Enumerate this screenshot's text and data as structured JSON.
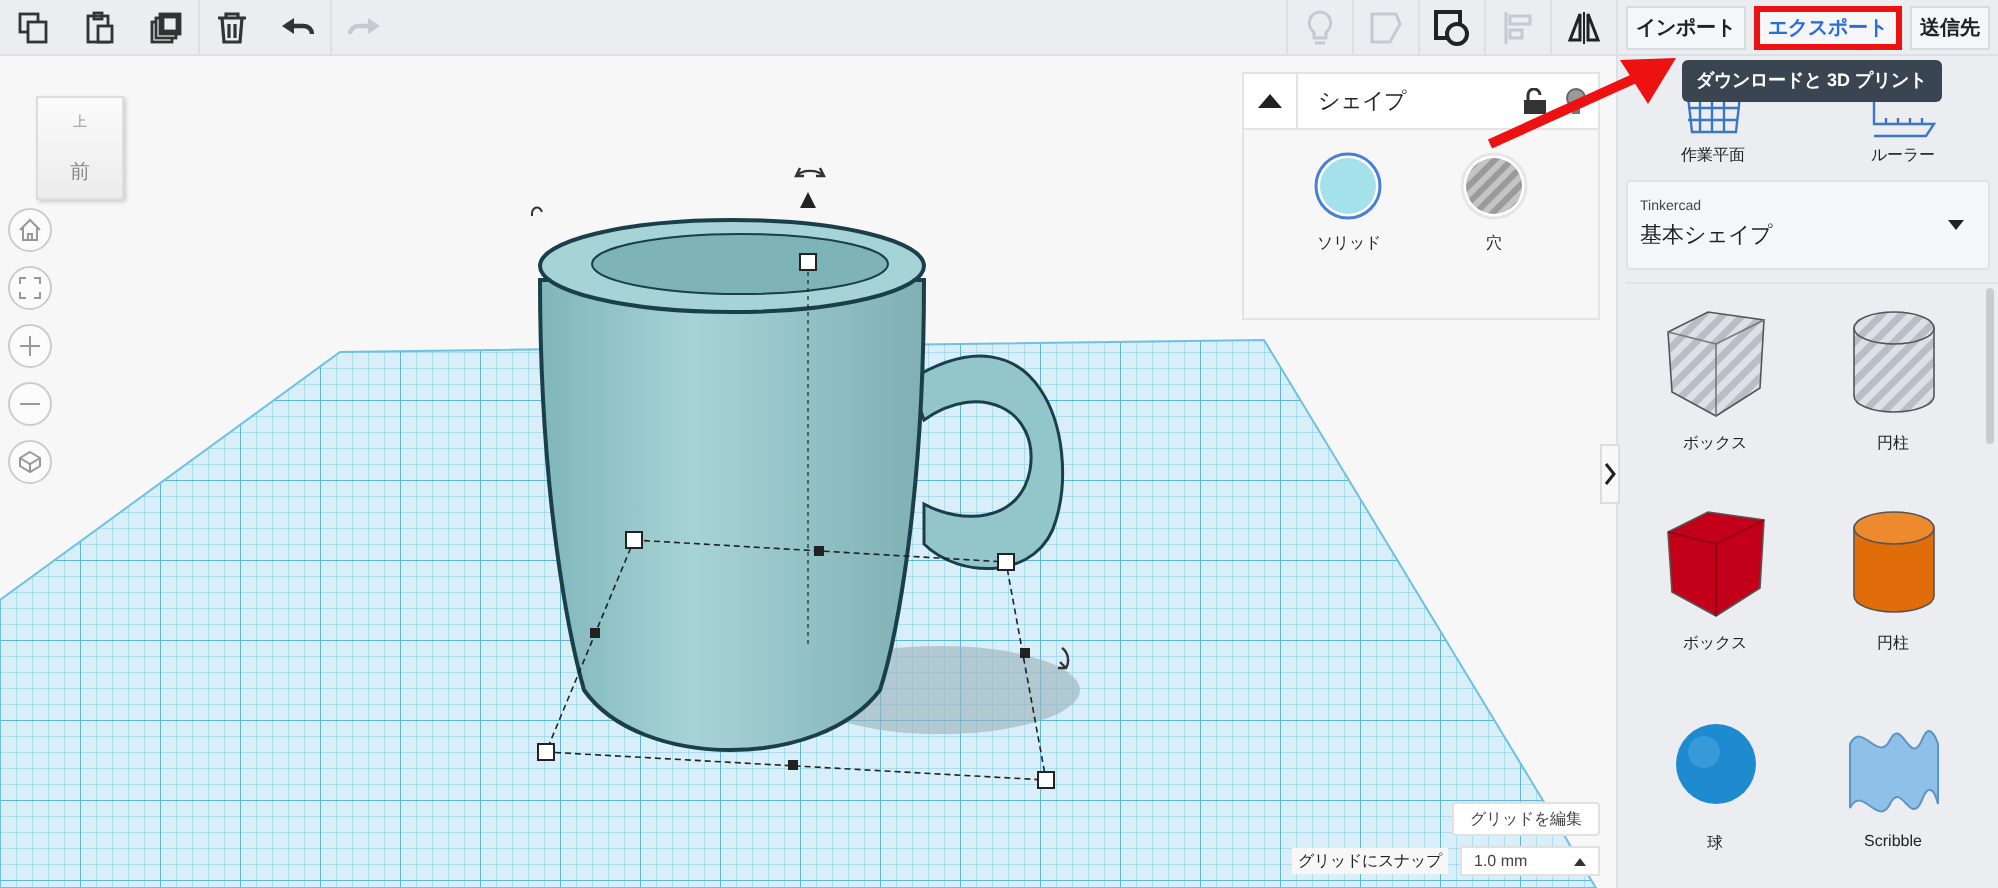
{
  "toolbar": {
    "left": [
      {
        "kind": "copy",
        "disabled": false
      },
      {
        "kind": "paste",
        "disabled": false
      },
      {
        "kind": "duplicate",
        "disabled": false
      },
      {
        "kind": "delete",
        "disabled": false
      },
      {
        "kind": "undo",
        "disabled": false
      },
      {
        "kind": "redo",
        "disabled": true
      }
    ],
    "right": [
      {
        "kind": "bulb",
        "disabled": true
      },
      {
        "kind": "note",
        "disabled": true
      },
      {
        "kind": "group",
        "disabled": false
      },
      {
        "kind": "align",
        "disabled": true
      },
      {
        "kind": "mirror",
        "disabled": false
      }
    ],
    "buttons": [
      {
        "label": "インポート",
        "highlighted": false
      },
      {
        "label": "エクスポート",
        "highlighted": true
      },
      {
        "label": "送信先",
        "highlighted": false
      }
    ],
    "tooltip": "ダウンロードと 3D プリント"
  },
  "view_cube": {
    "top": "上",
    "front": "前"
  },
  "nav_buttons": [
    {
      "kind": "home"
    },
    {
      "kind": "fit"
    },
    {
      "kind": "zoom-in"
    },
    {
      "kind": "zoom-out"
    },
    {
      "kind": "perspective"
    }
  ],
  "inspector": {
    "title": "シェイプ",
    "options": [
      {
        "label": "ソリッド",
        "kind": "solid",
        "selected": true
      },
      {
        "label": "穴",
        "kind": "hole",
        "selected": false
      }
    ]
  },
  "grid": {
    "edit_button": "グリッドを編集",
    "snap_label": "グリッドにスナップ",
    "snap_value": "1.0 mm"
  },
  "panel": {
    "tools": [
      {
        "label": "作業平面",
        "kind": "workplane"
      },
      {
        "label": "ルーラー",
        "kind": "ruler"
      }
    ],
    "library": {
      "label": "Tinkercad",
      "value": "基本シェイプ"
    },
    "shapes": [
      {
        "label": "ボックス",
        "kind": "box-hole"
      },
      {
        "label": "円柱",
        "kind": "cylinder-hole"
      },
      {
        "label": "ボックス",
        "kind": "box"
      },
      {
        "label": "円柱",
        "kind": "cylinder"
      },
      {
        "label": "球",
        "kind": "sphere"
      },
      {
        "label": "Scribble",
        "kind": "scribble"
      }
    ]
  }
}
